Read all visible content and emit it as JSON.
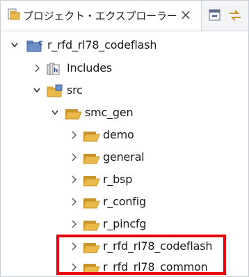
{
  "view": {
    "tab_title": "プロジェクト・エクスプローラー",
    "close_glyph": "×",
    "project": "r_rfd_rl78_codeflash",
    "tree": [
      {
        "label": "Includes"
      },
      {
        "label": "src"
      },
      {
        "label": "smc_gen"
      },
      {
        "label": "demo"
      },
      {
        "label": "general"
      },
      {
        "label": "r_bsp"
      },
      {
        "label": "r_config"
      },
      {
        "label": "r_pincfg"
      },
      {
        "label": "r_rfd_rl78_codeflash"
      },
      {
        "label": "r_rfd_rl78_common"
      }
    ]
  },
  "colors": {
    "highlight": "#e8000f",
    "folder": "#e9b949",
    "folder_dark": "#c9922a"
  }
}
